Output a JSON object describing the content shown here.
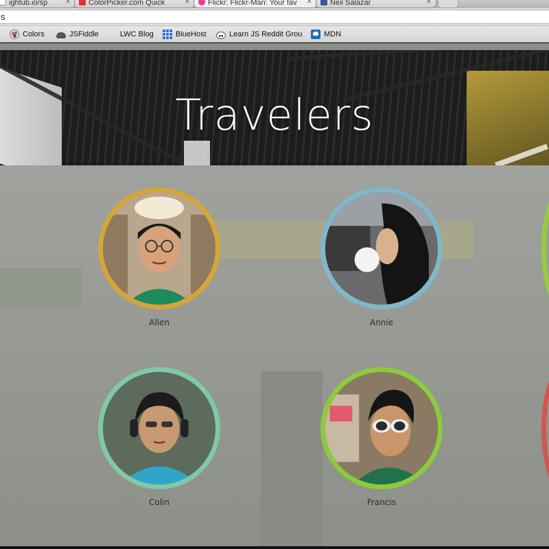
{
  "browser": {
    "tabs": [
      {
        "label": "ightub.io/sp",
        "favicon_color": "#ffffff"
      },
      {
        "label": "ColorPicker.com    Quick",
        "favicon_color": "#d33"
      },
      {
        "label": "Flickr: Flickr-Man: Your fav",
        "favicon_color": "#e84393"
      },
      {
        "label": "Neil Salazar",
        "favicon_color": "#3b5998"
      }
    ],
    "address_text": "s",
    "bookmarks": [
      {
        "label": "Colors",
        "icon": "palette-icon"
      },
      {
        "label": "JSFiddle",
        "icon": "cloud-icon"
      },
      {
        "label": "LWC Blog",
        "icon": ""
      },
      {
        "label": "BlueHost",
        "icon": "grid-icon"
      },
      {
        "label": "Learn JS Reddit Grou",
        "icon": "reddit-icon"
      },
      {
        "label": "MDN",
        "icon": "mdn-icon"
      }
    ]
  },
  "page": {
    "title": "Travelers",
    "travelers": [
      {
        "name": "Allen",
        "ring_color": "#d4a63a"
      },
      {
        "name": "Annie",
        "ring_color": "#7fb8c9"
      },
      {
        "name": "Colin",
        "ring_color": "#7fc9a6"
      },
      {
        "name": "Francis",
        "ring_color": "#8ccb3c"
      }
    ],
    "partial_ring_colors": [
      "#9acb3a",
      "#d8534a"
    ]
  }
}
